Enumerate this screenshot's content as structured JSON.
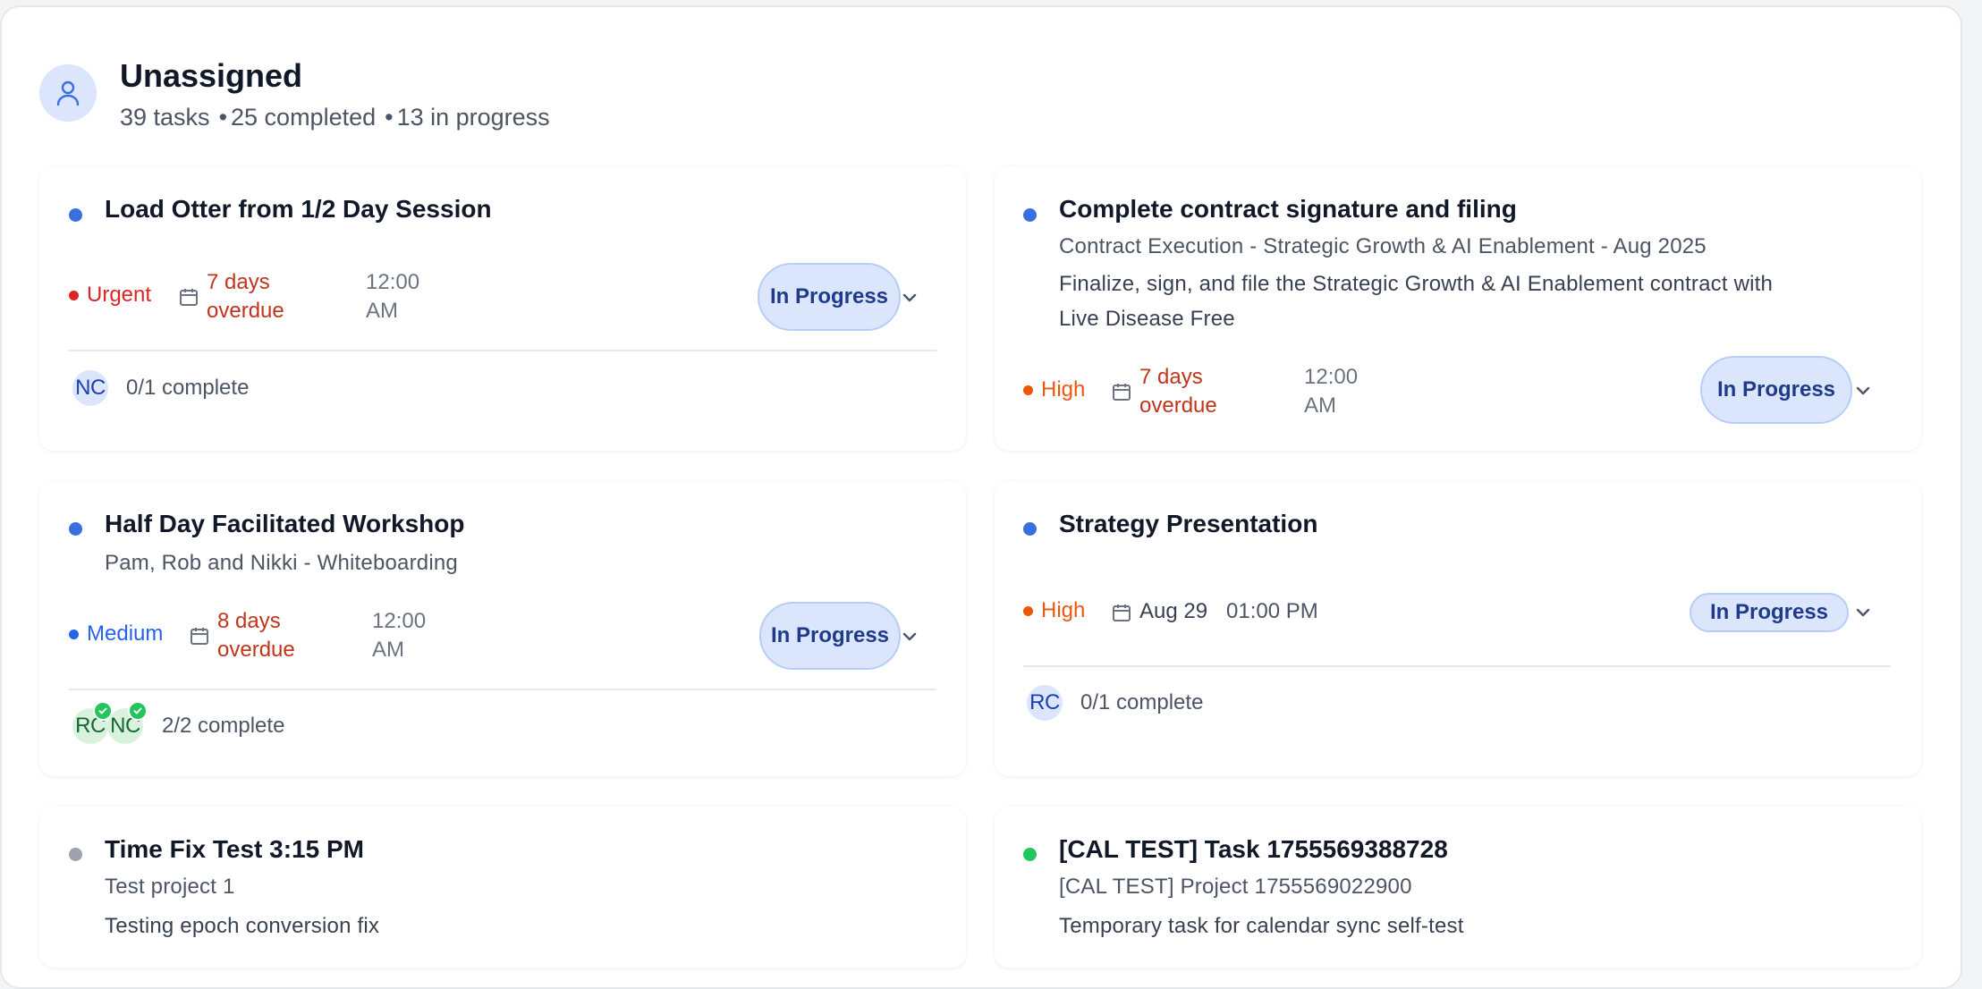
{
  "group": {
    "title": "Unassigned",
    "stats": [
      "39 tasks",
      "25 completed",
      "13 in progress"
    ],
    "separator": "•",
    "icon": "user-icon"
  },
  "colors": {
    "accent": "#3b6fe0",
    "urgent": "#dc2626",
    "high": "#ea580c",
    "medium": "#2563eb",
    "overdue": "#c2341b",
    "status_pill": "#dbe6fc",
    "complete_green": "#22c55e"
  },
  "tasks": [
    {
      "title": "Load Otter from 1/2 Day Session",
      "priority": "Urgent",
      "due": "7 days overdue",
      "time": "12:00 AM",
      "status": "In Progress",
      "assignees": [
        "NC"
      ],
      "progress": "0/1 complete"
    },
    {
      "title": "Complete contract signature and filing",
      "project": "Contract Execution - Strategic Growth & AI Enablement - Aug 2025",
      "description": "Finalize, sign, and file the Strategic Growth & AI Enablement contract with Live Disease Free",
      "priority": "High",
      "due": "7 days overdue",
      "time": "12:00 AM",
      "status": "In Progress"
    },
    {
      "title": "Half Day Facilitated Workshop",
      "project": "Pam, Rob and Nikki - Whiteboarding",
      "priority": "Medium",
      "due": "8 days overdue",
      "time": "12:00 AM",
      "status": "In Progress",
      "assignees": [
        "RC",
        "NC"
      ],
      "progress": "2/2 complete"
    },
    {
      "title": "Strategy Presentation",
      "priority": "High",
      "due": "Aug 29",
      "time": "01:00 PM",
      "status": "In Progress",
      "assignees": [
        "RC"
      ],
      "progress": "0/1 complete"
    },
    {
      "title": "Time Fix Test 3:15 PM",
      "project": "Test project 1",
      "description": "Testing epoch conversion fix"
    },
    {
      "title": "[CAL TEST] Task 1755569388728",
      "project": "[CAL TEST] Project 1755569022900",
      "description": "Temporary task for calendar sync self-test"
    }
  ]
}
